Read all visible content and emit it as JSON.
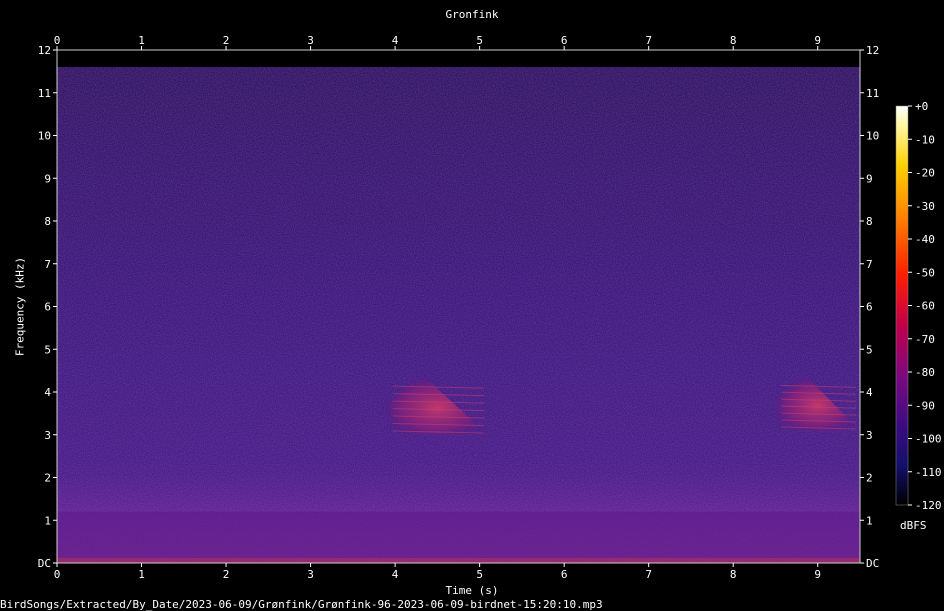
{
  "chart_data": {
    "type": "heatmap",
    "title": "Gronfink",
    "xlabel": "Time (s)",
    "ylabel": "Frequency (kHz)",
    "xlim": [
      0,
      9.5
    ],
    "ylim": [
      0,
      12
    ],
    "x_ticks": [
      "0",
      "1",
      "2",
      "3",
      "4",
      "5",
      "6",
      "7",
      "8",
      "9"
    ],
    "y_ticks": [
      "DC",
      "1",
      "2",
      "3",
      "4",
      "5",
      "6",
      "7",
      "8",
      "9",
      "10",
      "11",
      "12"
    ],
    "colorbar": {
      "unit": "dBFS",
      "ticks": [
        "+0",
        "-10",
        "-20",
        "-30",
        "-40",
        "-50",
        "-60",
        "-70",
        "-80",
        "-90",
        "-100",
        "-110",
        "-120"
      ],
      "range": [
        -120,
        0
      ]
    },
    "calls": [
      {
        "t_start": 3.9,
        "t_end": 5.1,
        "f_low": 3.0,
        "f_high": 4.4
      },
      {
        "t_start": 8.5,
        "t_end": 9.5,
        "f_low": 3.1,
        "f_high": 4.4
      }
    ],
    "noise_floor_band": {
      "f_low": 0,
      "f_high": 1.2
    }
  },
  "footer": {
    "path": "BirdSongs/Extracted/By_Date/2023-06-09/Grønfink/Grønfink-96-2023-06-09-birdnet-15:20:10.mp3"
  },
  "colors": {
    "background": "#000000",
    "plot_base": "#2a0f6a",
    "noise_band": "#5a1a8a",
    "call": "#b0305a"
  }
}
